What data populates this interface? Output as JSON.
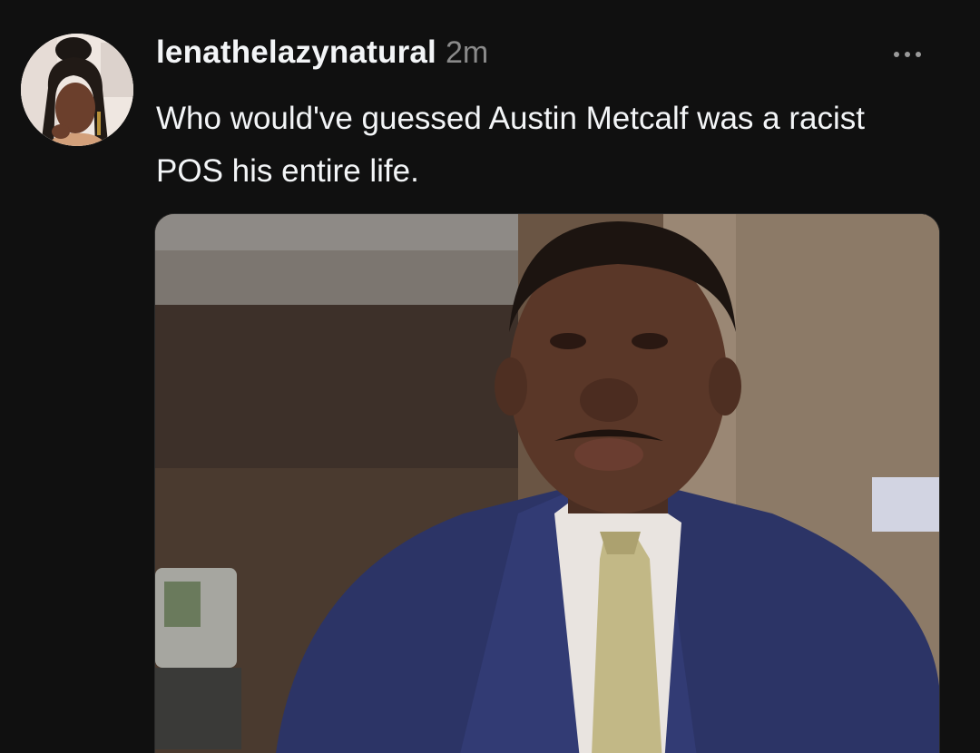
{
  "post": {
    "username": "lenathelazynatural",
    "timestamp": "2m",
    "text": "Who would've guessed Austin Metcalf was a racist POS his entire life.",
    "more_icon": "more-horizontal-icon",
    "media": {
      "kind": "gif"
    }
  },
  "colors": {
    "background": "#101010",
    "primary_text": "#f3f5f7",
    "secondary_text": "#8a8a8a"
  }
}
